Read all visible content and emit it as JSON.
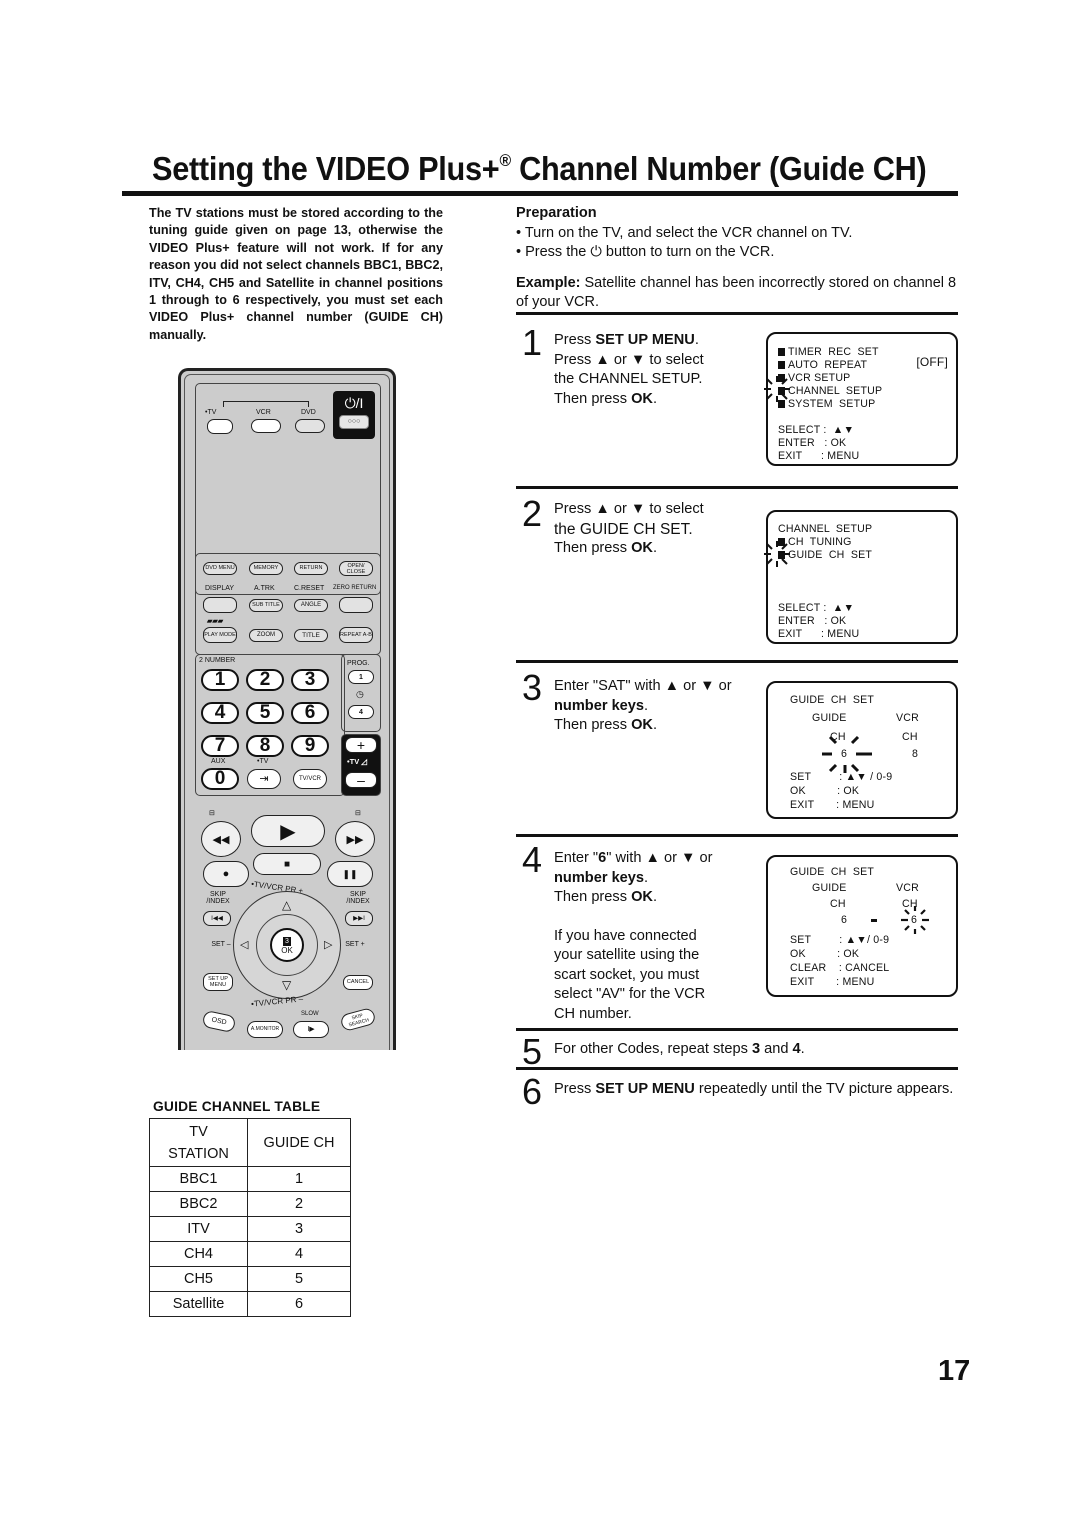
{
  "page": {
    "title_main": "Setting the VIDEO Plus+",
    "title_reg": "®",
    "title_rest": " Channel Number (Guide CH)",
    "page_number": "17"
  },
  "intro": {
    "text": "The TV stations must be stored according to the tuning guide given on page 13, otherwise the VIDEO Plus+ feature will not work. If for any reason you did not select channels BBC1, BBC2, ITV, CH4, CH5 and Satellite in channel positions 1 through to 6 respectively, you must set each VIDEO Plus+ channel number (GUIDE CH) manually."
  },
  "preparation": {
    "heading": "Preparation",
    "bullet1": "• Turn on the TV, and select the VCR channel on TV.",
    "bullet2_pre": "• Press the",
    "bullet2_icon": "⏻",
    "bullet2_post": "button to turn on the VCR.",
    "example_label": "Example:",
    "example_text": " Satellite channel has been incorrectly stored on channel 8 of your VCR."
  },
  "steps": [
    {
      "num": "1",
      "lines": [
        {
          "pre": "Press ",
          "bold": "SET UP MENU",
          "post": "."
        },
        {
          "pre": "Press ▲ or ▼ to select",
          "bold": "",
          "post": ""
        },
        {
          "pre": "the CHANNEL SETUP.",
          "bold": "",
          "post": ""
        },
        {
          "pre": "Then press ",
          "bold": "OK",
          "post": "."
        }
      ],
      "osd": {
        "items": [
          "TIMER  REC  SET",
          "AUTO  REPEAT",
          "VCR SETUP",
          "CHANNEL  SETUP",
          "SYSTEM  SETUP"
        ],
        "auto_repeat_value": "[OFF]",
        "select": "SELECT :  ▲▼",
        "enter": "ENTER   : OK",
        "exit": "EXIT      : MENU"
      }
    },
    {
      "num": "2",
      "lines": [
        {
          "pre": "Press  ▲ or ▼ to select",
          "bold": "",
          "post": ""
        },
        {
          "pre": "the GUIDE CH SET.",
          "bold": "",
          "post": ""
        },
        {
          "pre": "Then press ",
          "bold": "OK",
          "post": "."
        }
      ],
      "osd": {
        "title": "CHANNEL  SETUP",
        "items": [
          "CH  TUNING",
          "GUIDE  CH  SET"
        ],
        "select": "SELECT :  ▲▼",
        "enter": "ENTER   : OK",
        "exit": "EXIT      : MENU"
      }
    },
    {
      "num": "3",
      "lines": [
        {
          "pre": "Enter \"SAT\" with ▲ or ▼ or",
          "bold": "",
          "post": ""
        },
        {
          "pre": "",
          "bold": "number  keys",
          "post": "."
        },
        {
          "pre": "Then press ",
          "bold": "OK",
          "post": "."
        }
      ],
      "osd": {
        "title": "GUIDE  CH  SET",
        "col1": "GUIDE",
        "col2": "VCR",
        "ch1": "CH",
        "ch2": "CH",
        "guide_value": "6",
        "vcr_value": "8",
        "set": "SET         : ▲▼ / 0-9",
        "ok": "OK          : OK",
        "exit": "EXIT       : MENU"
      }
    },
    {
      "num": "4",
      "lines": [
        {
          "pre": "Enter \"",
          "bold": "6",
          "post": "\" with ▲ or ▼ or"
        },
        {
          "pre": "",
          "bold": "number  keys",
          "post": "."
        },
        {
          "pre": "Then press ",
          "bold": "OK",
          "post": "."
        }
      ],
      "note": [
        "If you have connected",
        "your satellite using the",
        "scart socket, you must",
        "select \"AV\" for the VCR",
        "CH number."
      ],
      "osd": {
        "title": "GUIDE  CH  SET",
        "col1": "GUIDE",
        "col2": "VCR",
        "ch1": "CH",
        "ch2": "CH",
        "guide_value": "6",
        "vcr_value": "6",
        "set": "SET         : ▲▼/ 0-9",
        "ok": "OK          : OK",
        "clear": "CLEAR    : CANCEL",
        "exit": "EXIT       : MENU"
      }
    },
    {
      "num": "5",
      "text_pre": "For other Codes, repeat steps ",
      "b1": "3",
      "text_mid": " and ",
      "b2": "4",
      "text_post": "."
    },
    {
      "num": "6",
      "text_pre": "Press ",
      "bold": "SET UP MENU",
      "text_post": " repeatedly until the TV picture appears."
    }
  ],
  "guide_table": {
    "title": "GUIDE CHANNEL TABLE",
    "header_col1_line1": "TV",
    "header_col1_line2": "STATION",
    "header_col2": "GUIDE CH",
    "rows": [
      {
        "station": "BBC1",
        "ch": "1"
      },
      {
        "station": "BBC2",
        "ch": "2"
      },
      {
        "station": "ITV",
        "ch": "3"
      },
      {
        "station": "CH4",
        "ch": "4"
      },
      {
        "station": "CH5",
        "ch": "5"
      },
      {
        "station": "Satellite",
        "ch": "6"
      }
    ]
  },
  "remote": {
    "mode_tv": "•TV",
    "mode_vcr": "VCR",
    "mode_dvd": "DVD",
    "power_label": "⏻/I",
    "power_sub": "○○○",
    "row1": [
      "DVD MENU",
      "MEMORY",
      "RETURN",
      "OPEN/ CLOSE"
    ],
    "row2_labels": [
      "DISPLAY",
      "A.TRK",
      "C.RESET",
      "ZERO RETURN"
    ],
    "row2_buttons": [
      "",
      "SUB TITLE",
      "ANGLE",
      ""
    ],
    "row3": [
      "PLAY MODE",
      "ZOOM",
      "TITLE",
      "REPEAT A-B"
    ],
    "number_label": "2 NUMBER",
    "prog_label": "PROG.",
    "prog_btn1": "1",
    "prog_btn2": "4",
    "digits": [
      "1",
      "2",
      "3",
      "4",
      "5",
      "6",
      "7",
      "8",
      "9",
      "0"
    ],
    "aux_label": "AUX",
    "tv_label": "•TV",
    "input_icon": "⇥",
    "tvvcr": "TV/VCR",
    "vol_plus": "+",
    "vol_label": "•TV ◿",
    "vol_minus": "–",
    "rew": "◀◀",
    "play": "▶",
    "ff": "▶▶",
    "rec": "●",
    "stop": "■",
    "pause": "❚❚",
    "skip_index": "SKIP /INDEX",
    "tvvcr_pr_plus": "•TV/VCR PR +",
    "tvvcr_pr_minus": "•TV/VCR PR –",
    "skip_prev": "I◀◀",
    "skip_next": "▶▶I",
    "set_minus": "SET –",
    "set_plus": "SET +",
    "ok": "OK",
    "ok_num": "3",
    "up": "△",
    "down": "▽",
    "left": "◁",
    "right": "▷",
    "setup_menu": "SET UP MENU",
    "cancel": "CANCEL",
    "osd": "OSD",
    "amonitor": "A.MONITOR",
    "slow_label": "SLOW",
    "slow": "I▶",
    "skip_search": "SKIP SEARCH"
  }
}
